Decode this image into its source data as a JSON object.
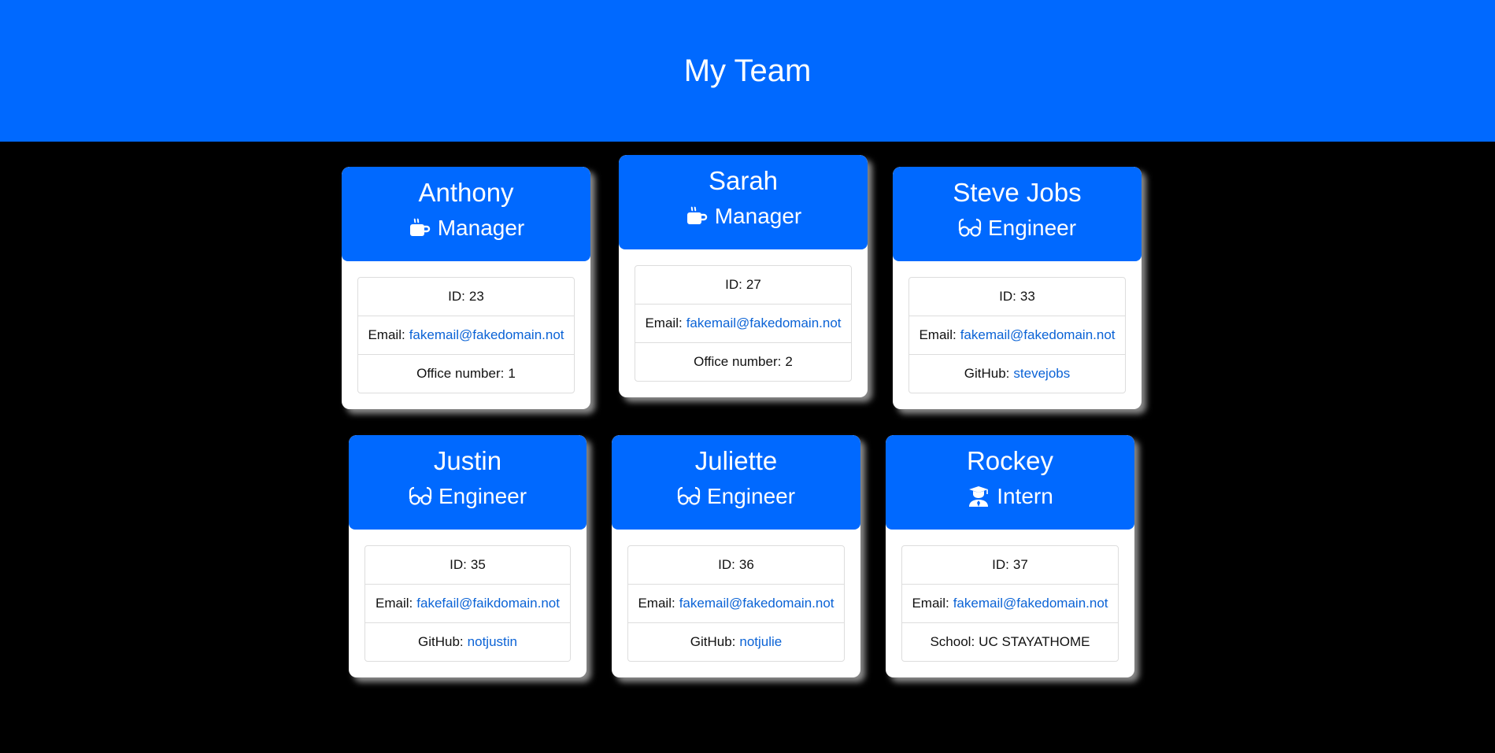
{
  "page": {
    "title": "My Team",
    "colors": {
      "banner": "#0069ff",
      "background": "#000000",
      "link": "#0b63d6"
    }
  },
  "labels": {
    "id": "ID:",
    "email": "Email:",
    "office": "Office number:",
    "github": "GitHub:",
    "school": "School:"
  },
  "cards": [
    {
      "name": "Anthony",
      "role": "Manager",
      "icon": "mug-icon",
      "id": "23",
      "email": "fakemail@fakedomain.not",
      "extra_value": "1"
    },
    {
      "name": "Sarah",
      "role": "Manager",
      "icon": "mug-icon",
      "id": "27",
      "email": "fakemail@fakedomain.not",
      "extra_value": "2"
    },
    {
      "name": "Steve Jobs",
      "role": "Engineer",
      "icon": "glasses-icon",
      "id": "33",
      "email": "fakemail@fakedomain.not",
      "extra_value": "stevejobs"
    },
    {
      "name": "Justin",
      "role": "Engineer",
      "icon": "glasses-icon",
      "id": "35",
      "email": "fakefail@faikdomain.not",
      "extra_value": "notjustin"
    },
    {
      "name": "Juliette",
      "role": "Engineer",
      "icon": "glasses-icon",
      "id": "36",
      "email": "fakemail@fakedomain.not",
      "extra_value": "notjulie"
    },
    {
      "name": "Rockey",
      "role": "Intern",
      "icon": "graduate-icon",
      "id": "37",
      "email": "fakemail@fakedomain.not",
      "extra_value": "UC STAYATHOME"
    }
  ]
}
